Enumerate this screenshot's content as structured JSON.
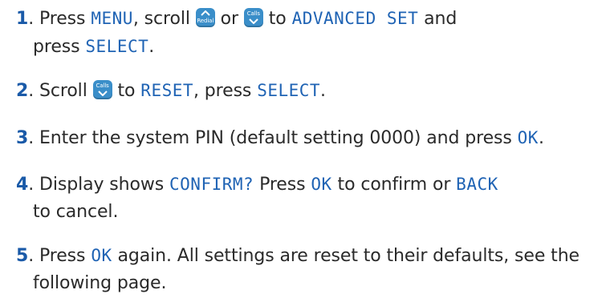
{
  "steps": [
    {
      "num": "1",
      "a": ". Press ",
      "menu": "MENU",
      "b": ", scroll ",
      "key1": "Redial",
      "or": " or ",
      "key2": "Calls",
      "c": " to ",
      "target": "ADVANCED SET",
      "d": " and",
      "e": "press ",
      "select": "SELECT",
      "f": "."
    },
    {
      "num": "2",
      "a": ". Scroll ",
      "key": "Calls",
      "b": " to ",
      "reset": "RESET",
      "c": ", press ",
      "select": "SELECT",
      "d": "."
    },
    {
      "num": "3",
      "a": ". Enter the system PIN (default setting 0000) and press ",
      "ok": "OK",
      "b": "."
    },
    {
      "num": "4",
      "a": ". Display shows ",
      "confirm": "CONFIRM?",
      "b": " Press ",
      "ok": "OK",
      "c": " to confirm or ",
      "back": "BACK",
      "d": "to cancel."
    },
    {
      "num": "5",
      "a": ". Press ",
      "ok": "OK",
      "b": " again. All settings are reset to their defaults, see the",
      "c": "following page."
    }
  ],
  "icons": {
    "redial_key": "chevron-up-icon",
    "calls_key": "chevron-down-icon"
  },
  "colors": {
    "step_number": "#1a5aa8",
    "lcd_text": "#1f63b4",
    "key_background": "#3a8ec9",
    "body_text": "#2a2a2a"
  }
}
